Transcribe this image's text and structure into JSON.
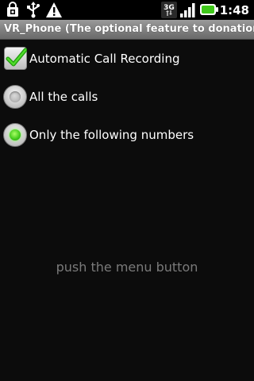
{
  "status_bar": {
    "icons": [
      "lock-icon",
      "usb-icon",
      "warning-icon",
      "3g-icon",
      "signal-icon",
      "battery-icon"
    ],
    "network_label": "3G",
    "time": "1:48",
    "battery_color": "#3fc81a"
  },
  "title_bar": {
    "title": "VR_Phone (The optional feature to donation)"
  },
  "settings": {
    "auto_record": {
      "label": "Automatic Call Recording",
      "checked": true
    },
    "mode_options": [
      {
        "label": "All the calls",
        "selected": false
      },
      {
        "label": "Only the following numbers",
        "selected": true
      }
    ]
  },
  "hint": {
    "text": "push the menu button"
  },
  "colors": {
    "background": "#0c0c0c",
    "accent_green": "#3fc81a",
    "hint_text": "#7a7a7a"
  }
}
